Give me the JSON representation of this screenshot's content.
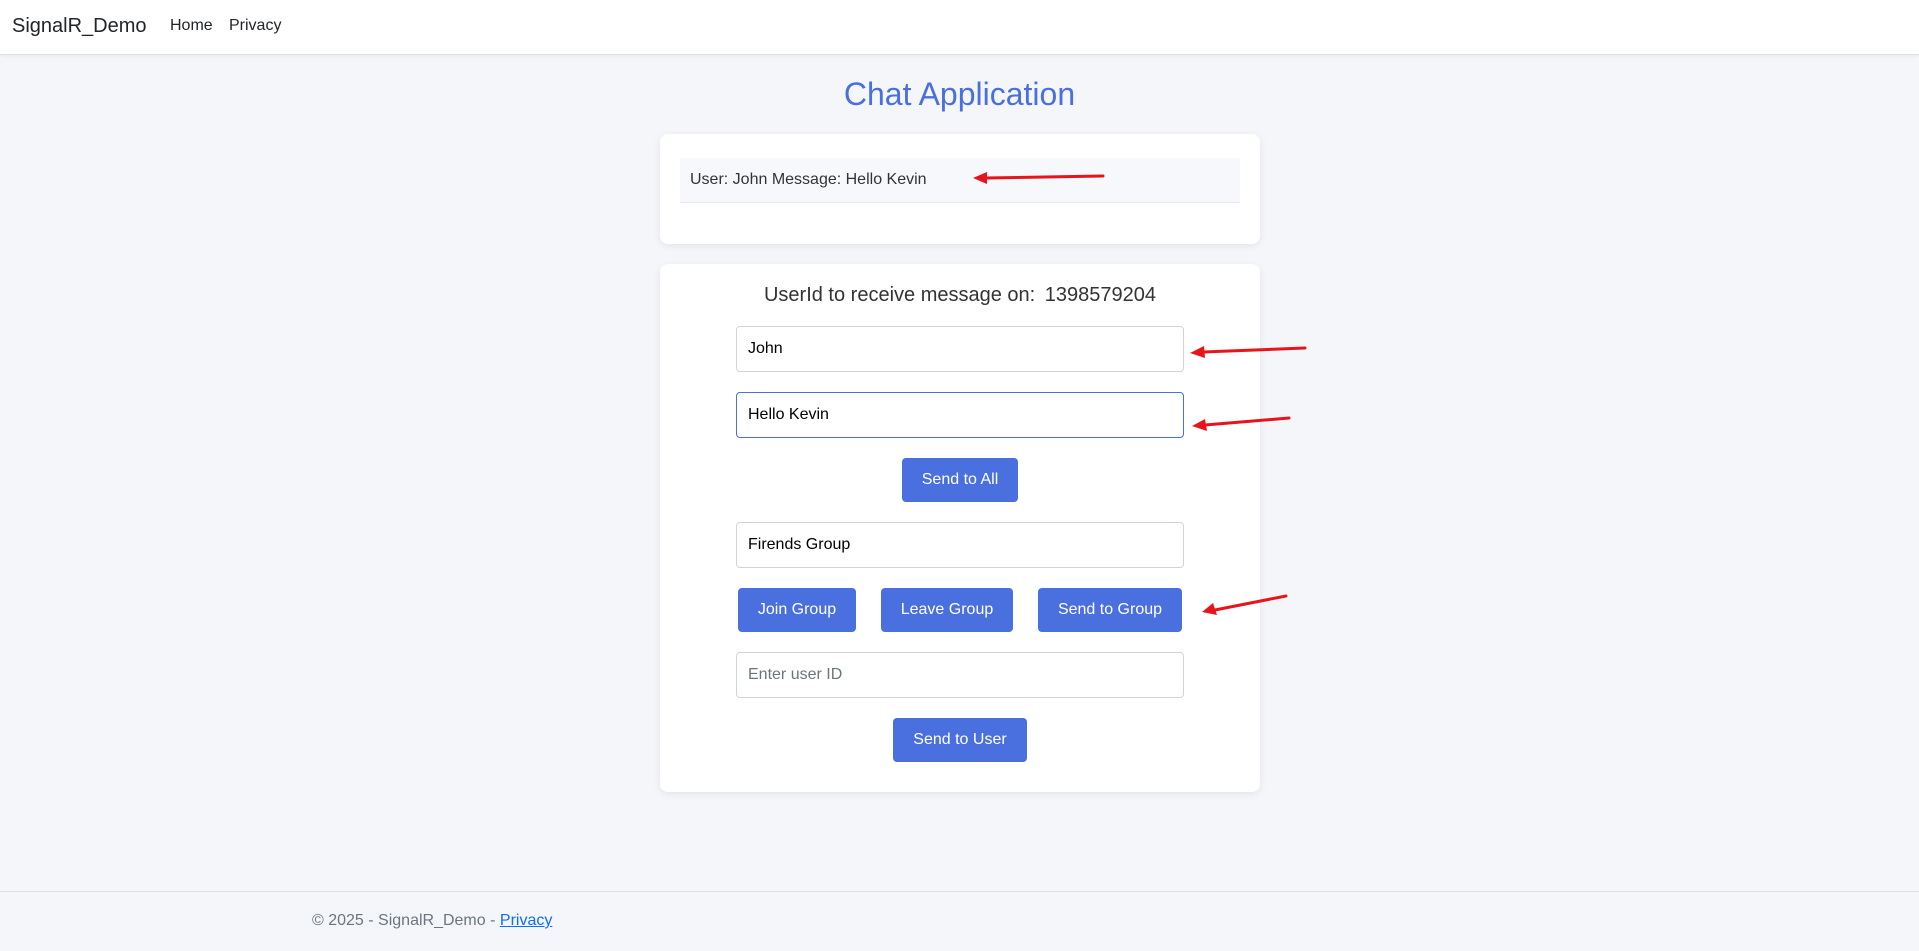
{
  "navbar": {
    "brand": "SignalR_Demo",
    "links": [
      "Home",
      "Privacy"
    ]
  },
  "page": {
    "title": "Chat Application"
  },
  "messages": [
    {
      "text": "User: John Message: Hello Kevin"
    }
  ],
  "form": {
    "userid_label": "UserId to receive message on:",
    "userid_value": "1398579204",
    "user_input_value": "John",
    "message_input_value": "Hello Kevin",
    "send_all_label": "Send to All",
    "group_input_value": "Firends Group",
    "join_group_label": "Join Group",
    "leave_group_label": "Leave Group",
    "send_group_label": "Send to Group",
    "userid_input_placeholder": "Enter user ID",
    "send_user_label": "Send to User"
  },
  "footer": {
    "copyright": "© 2025 - SignalR_Demo -",
    "privacy_link": "Privacy"
  },
  "colors": {
    "accent": "#4a6fde",
    "annotation": "#e8141b",
    "background": "#f4f6fa"
  }
}
